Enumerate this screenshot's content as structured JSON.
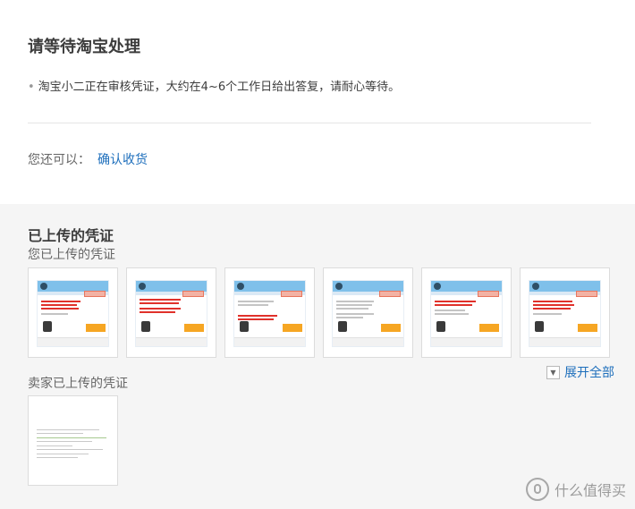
{
  "status": {
    "title": "请等待淘宝处理",
    "notice": "淘宝小二正在审核凭证，大约在4~6个工作日给出答复，请耐心等待。",
    "also_label": "您还可以：",
    "confirm_link": "确认收货"
  },
  "vouchers": {
    "section_title": "已上传的凭证",
    "buyer_title": "您已上传的凭证",
    "buyer_count": 6,
    "expand_label": "展开全部",
    "seller_title": "卖家已上传的凭证",
    "seller_count": 1
  },
  "watermark": {
    "text": "什么值得买",
    "icon": "smzdm-logo-icon"
  },
  "colors": {
    "link": "#1e6fbc",
    "title": "#3c3c3c",
    "accent_red": "#e0312b",
    "accent_orange": "#f6a623"
  }
}
